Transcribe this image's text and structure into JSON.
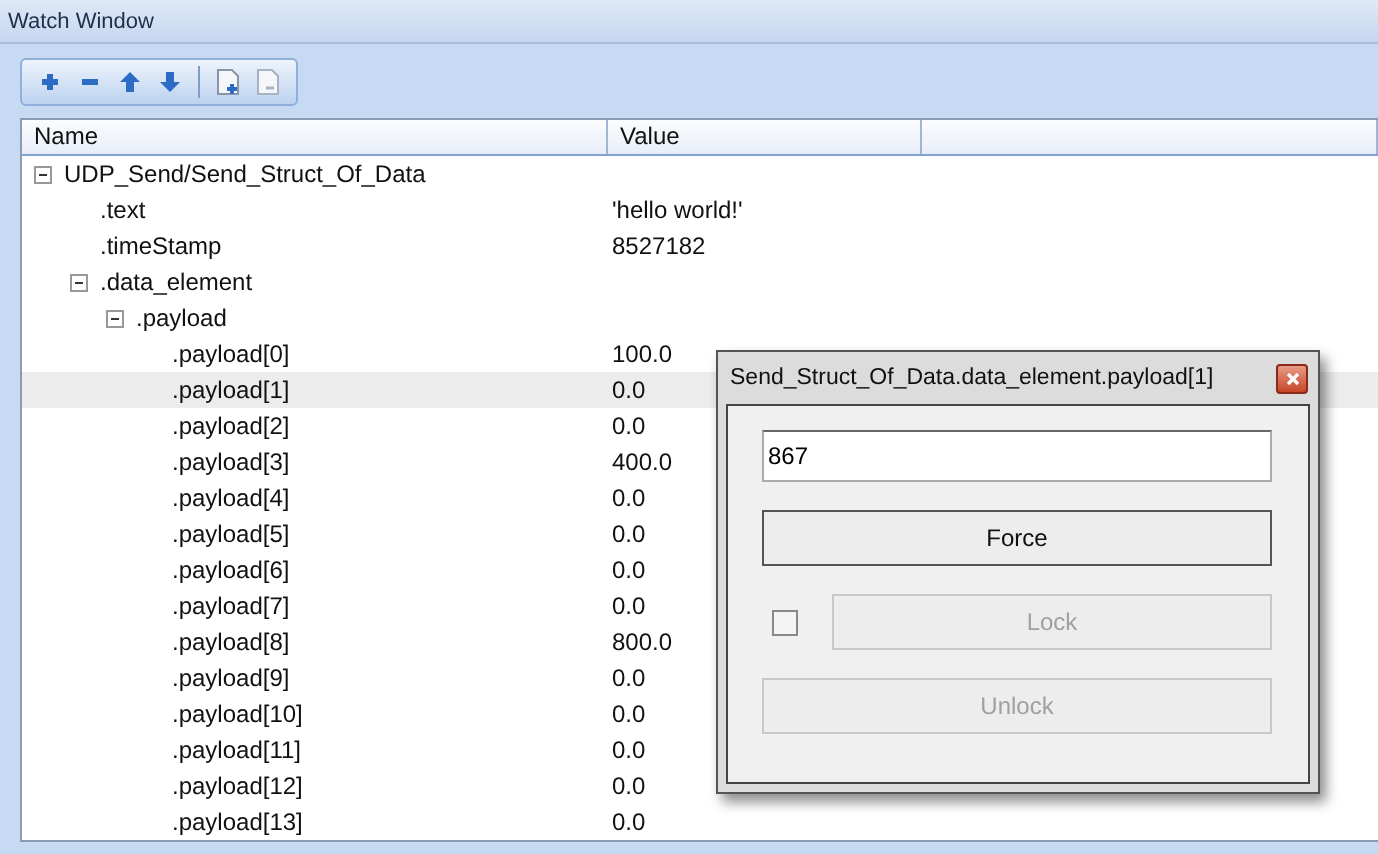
{
  "window": {
    "title": "Watch Window"
  },
  "toolbar": [
    {
      "kind": "plus",
      "disabled": false
    },
    {
      "kind": "minus",
      "disabled": false
    },
    {
      "kind": "up",
      "disabled": false
    },
    {
      "kind": "down",
      "disabled": false
    },
    {
      "kind": "sep"
    },
    {
      "kind": "doc-add",
      "disabled": false
    },
    {
      "kind": "doc-remove",
      "disabled": true
    }
  ],
  "table": {
    "columns": [
      "Name",
      "Value"
    ],
    "rows": [
      {
        "name": "UDP_Send/Send_Struct_Of_Data",
        "expanded": true,
        "selected": false,
        "children": [
          {
            "name": ".text",
            "value": "'hello world!'",
            "selected": false
          },
          {
            "name": ".timeStamp",
            "value": "8527182",
            "selected": false
          },
          {
            "name": ".data_element",
            "expanded": true,
            "selected": false,
            "children": [
              {
                "name": ".payload",
                "expanded": true,
                "selected": false,
                "children": [
                  {
                    "name": ".payload[0]",
                    "value": "100.0",
                    "selected": false
                  },
                  {
                    "name": ".payload[1]",
                    "value": "0.0",
                    "selected": true
                  },
                  {
                    "name": ".payload[2]",
                    "value": "0.0",
                    "selected": false
                  },
                  {
                    "name": ".payload[3]",
                    "value": "400.0",
                    "selected": false
                  },
                  {
                    "name": ".payload[4]",
                    "value": "0.0",
                    "selected": false
                  },
                  {
                    "name": ".payload[5]",
                    "value": "0.0",
                    "selected": false
                  },
                  {
                    "name": ".payload[6]",
                    "value": "0.0",
                    "selected": false
                  },
                  {
                    "name": ".payload[7]",
                    "value": "0.0",
                    "selected": false
                  },
                  {
                    "name": ".payload[8]",
                    "value": "800.0",
                    "selected": false
                  },
                  {
                    "name": ".payload[9]",
                    "value": "0.0",
                    "selected": false
                  },
                  {
                    "name": ".payload[10]",
                    "value": "0.0",
                    "selected": false
                  },
                  {
                    "name": ".payload[11]",
                    "value": "0.0",
                    "selected": false
                  },
                  {
                    "name": ".payload[12]",
                    "value": "0.0",
                    "selected": false
                  },
                  {
                    "name": ".payload[13]",
                    "value": "0.0",
                    "selected": false
                  }
                ]
              }
            ]
          }
        ]
      }
    ]
  },
  "dialog": {
    "title": "Send_Struct_Of_Data.data_element.payload[1]",
    "value": "867",
    "force": {
      "label": "Force",
      "disabled": false
    },
    "lock_checked": false,
    "lock": {
      "label": "Lock",
      "disabled": true
    },
    "unlock": {
      "label": "Unlock",
      "disabled": true
    }
  }
}
